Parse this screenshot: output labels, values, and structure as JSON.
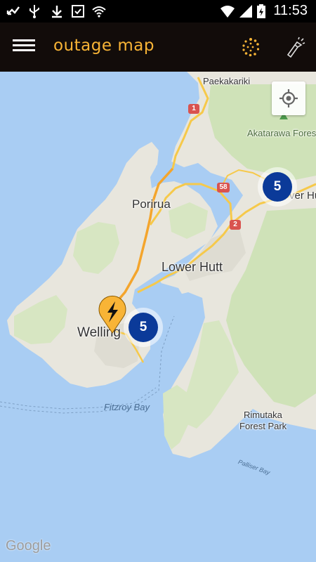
{
  "status_bar": {
    "time": "11:53"
  },
  "app_bar": {
    "title": "outage map"
  },
  "map": {
    "labels": {
      "paekakariki": "Paekakariki",
      "akatarawa": "Akatarawa Forest",
      "porirua": "Porirua",
      "lower_hutt": "Lower Hutt",
      "upper_hutt": "ver Hu",
      "wellington": "Welling",
      "fitzroy_bay": "Fitzroy Bay",
      "rimutaka_1": "Rimutaka",
      "rimutaka_2": "Forest Park",
      "palliser_bay": "Palliser Bay"
    },
    "road_shields": {
      "r1": "1",
      "r58": "58",
      "r2": "2"
    },
    "clusters": [
      {
        "count": "5"
      },
      {
        "count": "5"
      }
    ],
    "attribution": "Google"
  },
  "colors": {
    "app_bar": "#120c0a",
    "accent": "#f8b436",
    "cluster": "#0b3a99",
    "water": "#a9cdf3",
    "land": "#e8e6dd",
    "park": "#cfe2b8"
  }
}
